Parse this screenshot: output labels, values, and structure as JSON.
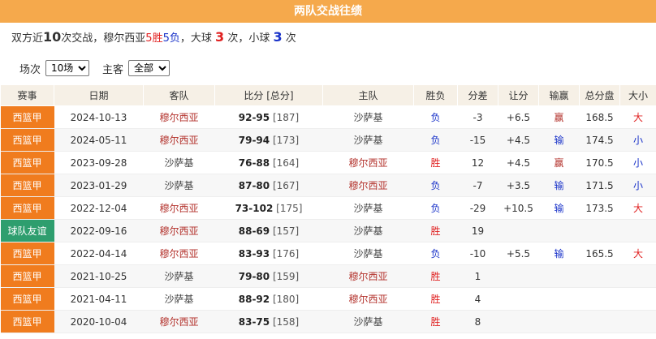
{
  "title": "两队交战往绩",
  "summary": {
    "prefix": "双方近",
    "games": "10",
    "mid": "次交战，穆尔西亚",
    "win_count": "5",
    "win_label": "胜",
    "lose_count": "5",
    "lose_label": "负",
    "big_prefix": "，大球",
    "big_count": "3",
    "big_suffix": "次，小球",
    "small_count": "3",
    "small_suffix": "次"
  },
  "filters": {
    "count_label": "场次",
    "count_value": "10场",
    "home_label": "主客",
    "home_value": "全部"
  },
  "colors": {
    "header_bar": "#f5a94c",
    "league_orange": "#f07c1e",
    "league_green": "#2e9e6e"
  },
  "columns": [
    "赛事",
    "日期",
    "客队",
    "比分 [总分]",
    "主队",
    "胜负",
    "分差",
    "让分",
    "输赢",
    "总分盘",
    "大小"
  ],
  "rows": [
    {
      "league": "西篮甲",
      "league_type": "orange",
      "date": "2024-10-13",
      "away": "穆尔西亚",
      "away_red": true,
      "score": "92-95",
      "total": "[187]",
      "home": "沙萨基",
      "home_red": false,
      "result": "负",
      "diff": "-3",
      "handicap": "+6.5",
      "hcp_result": "赢",
      "ou_line": "168.5",
      "ou": "大"
    },
    {
      "league": "西篮甲",
      "league_type": "orange",
      "date": "2024-05-11",
      "away": "穆尔西亚",
      "away_red": true,
      "score": "79-94",
      "total": "[173]",
      "home": "沙萨基",
      "home_red": false,
      "result": "负",
      "diff": "-15",
      "handicap": "+4.5",
      "hcp_result": "输",
      "ou_line": "174.5",
      "ou": "小"
    },
    {
      "league": "西篮甲",
      "league_type": "orange",
      "date": "2023-09-28",
      "away": "沙萨基",
      "away_red": false,
      "score": "76-88",
      "total": "[164]",
      "home": "穆尔西亚",
      "home_red": true,
      "result": "胜",
      "diff": "12",
      "handicap": "+4.5",
      "hcp_result": "赢",
      "ou_line": "170.5",
      "ou": "小"
    },
    {
      "league": "西篮甲",
      "league_type": "orange",
      "date": "2023-01-29",
      "away": "沙萨基",
      "away_red": false,
      "score": "87-80",
      "total": "[167]",
      "home": "穆尔西亚",
      "home_red": true,
      "result": "负",
      "diff": "-7",
      "handicap": "+3.5",
      "hcp_result": "输",
      "ou_line": "171.5",
      "ou": "小"
    },
    {
      "league": "西篮甲",
      "league_type": "orange",
      "date": "2022-12-04",
      "away": "穆尔西亚",
      "away_red": true,
      "score": "73-102",
      "total": "[175]",
      "home": "沙萨基",
      "home_red": false,
      "result": "负",
      "diff": "-29",
      "handicap": "+10.5",
      "hcp_result": "输",
      "ou_line": "173.5",
      "ou": "大"
    },
    {
      "league": "球队友谊",
      "league_type": "green",
      "date": "2022-09-16",
      "away": "穆尔西亚",
      "away_red": true,
      "score": "88-69",
      "total": "[157]",
      "home": "沙萨基",
      "home_red": false,
      "result": "胜",
      "diff": "19",
      "handicap": "",
      "hcp_result": "",
      "ou_line": "",
      "ou": ""
    },
    {
      "league": "西篮甲",
      "league_type": "orange",
      "date": "2022-04-14",
      "away": "穆尔西亚",
      "away_red": true,
      "score": "83-93",
      "total": "[176]",
      "home": "沙萨基",
      "home_red": false,
      "result": "负",
      "diff": "-10",
      "handicap": "+5.5",
      "hcp_result": "输",
      "ou_line": "165.5",
      "ou": "大"
    },
    {
      "league": "西篮甲",
      "league_type": "orange",
      "date": "2021-10-25",
      "away": "沙萨基",
      "away_red": false,
      "score": "79-80",
      "total": "[159]",
      "home": "穆尔西亚",
      "home_red": true,
      "result": "胜",
      "diff": "1",
      "handicap": "",
      "hcp_result": "",
      "ou_line": "",
      "ou": ""
    },
    {
      "league": "西篮甲",
      "league_type": "orange",
      "date": "2021-04-11",
      "away": "沙萨基",
      "away_red": false,
      "score": "88-92",
      "total": "[180]",
      "home": "穆尔西亚",
      "home_red": true,
      "result": "胜",
      "diff": "4",
      "handicap": "",
      "hcp_result": "",
      "ou_line": "",
      "ou": ""
    },
    {
      "league": "西篮甲",
      "league_type": "orange",
      "date": "2020-10-04",
      "away": "穆尔西亚",
      "away_red": true,
      "score": "83-75",
      "total": "[158]",
      "home": "沙萨基",
      "home_red": false,
      "result": "胜",
      "diff": "8",
      "handicap": "",
      "hcp_result": "",
      "ou_line": "",
      "ou": ""
    }
  ]
}
